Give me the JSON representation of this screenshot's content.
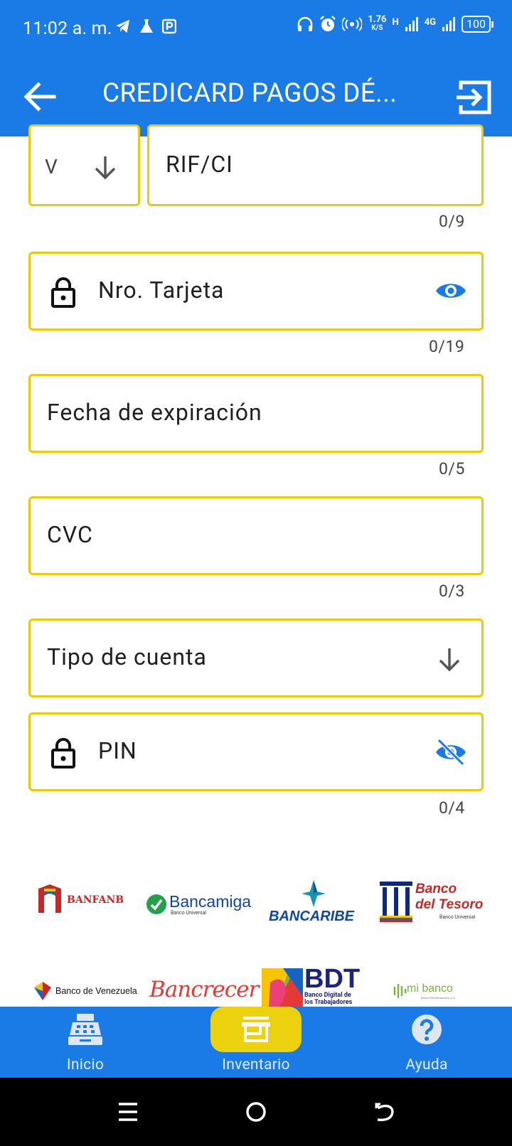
{
  "status_bar": {
    "time": "11:02 a. m.",
    "network_speed_value": "1.76",
    "network_speed_unit": "K/S",
    "network_type_1": "H",
    "network_type_2": "4G",
    "battery": "100"
  },
  "app_bar": {
    "title": "CREDICARD PAGOS DÉ..."
  },
  "form": {
    "doc_type_value": "V",
    "rif_label": "RIF/CI",
    "rif_counter": "0/9",
    "card_label": "Nro. Tarjeta",
    "card_counter": "0/19",
    "expiry_label": "Fecha de expiración",
    "expiry_counter": "0/5",
    "cvc_label": "CVC",
    "cvc_counter": "0/3",
    "account_type_label": "Tipo de cuenta",
    "pin_label": "PIN",
    "pin_counter": "0/4"
  },
  "banks": {
    "banfanb": "BANFANB",
    "bancamiga": "Bancamiga",
    "bancamiga_sub": "Banco Universal",
    "bancaribe": "BANCARIBE",
    "tesoro_1": "Banco",
    "tesoro_2": "del Tesoro",
    "tesoro_sub": "Banco Universal",
    "venezuela": "Banco de Venezuela",
    "bancrecer": "Bancrecer",
    "bdt": "BDT",
    "bdt_sub": "Banco Digital de los Trabajadores",
    "mibanco": "mi banco",
    "mibanco_sub": "Banco Microfinanciero, C.A."
  },
  "bottom_nav": {
    "items": [
      {
        "label": "Inicio"
      },
      {
        "label": "Inventario"
      },
      {
        "label": "Ayuda"
      }
    ]
  },
  "colors": {
    "primary": "#1a7be6",
    "field_border": "#e8cb0c",
    "active_pill": "#ecd10e"
  }
}
